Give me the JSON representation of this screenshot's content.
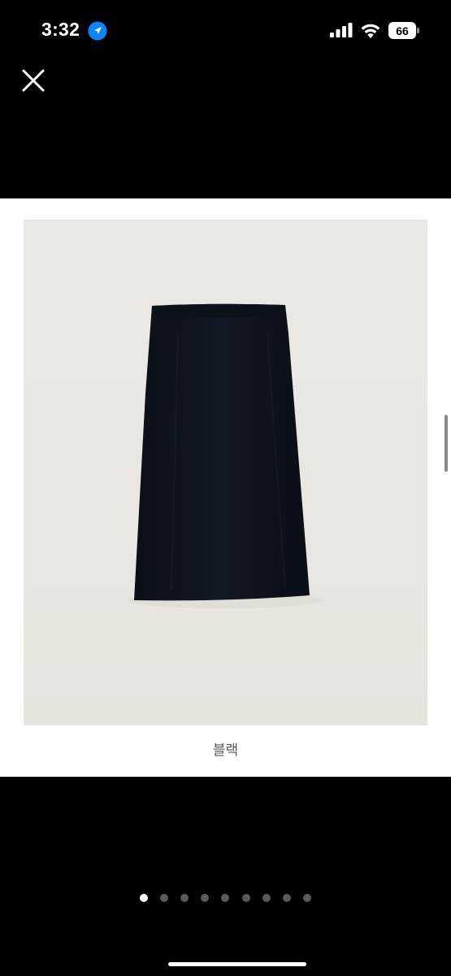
{
  "status_bar": {
    "time": "3:32",
    "battery_level": "66",
    "icons": [
      "location-arrow-icon",
      "cellular-signal-icon",
      "wifi-icon",
      "battery-icon"
    ]
  },
  "viewer": {
    "close_icon": "close-icon",
    "caption": "블랙",
    "page_count": 9,
    "current_page": 1
  },
  "colors": {
    "background": "#000000",
    "card": "#ffffff",
    "active_dot": "#ffffff",
    "inactive_dot": "#5a5a5a"
  }
}
